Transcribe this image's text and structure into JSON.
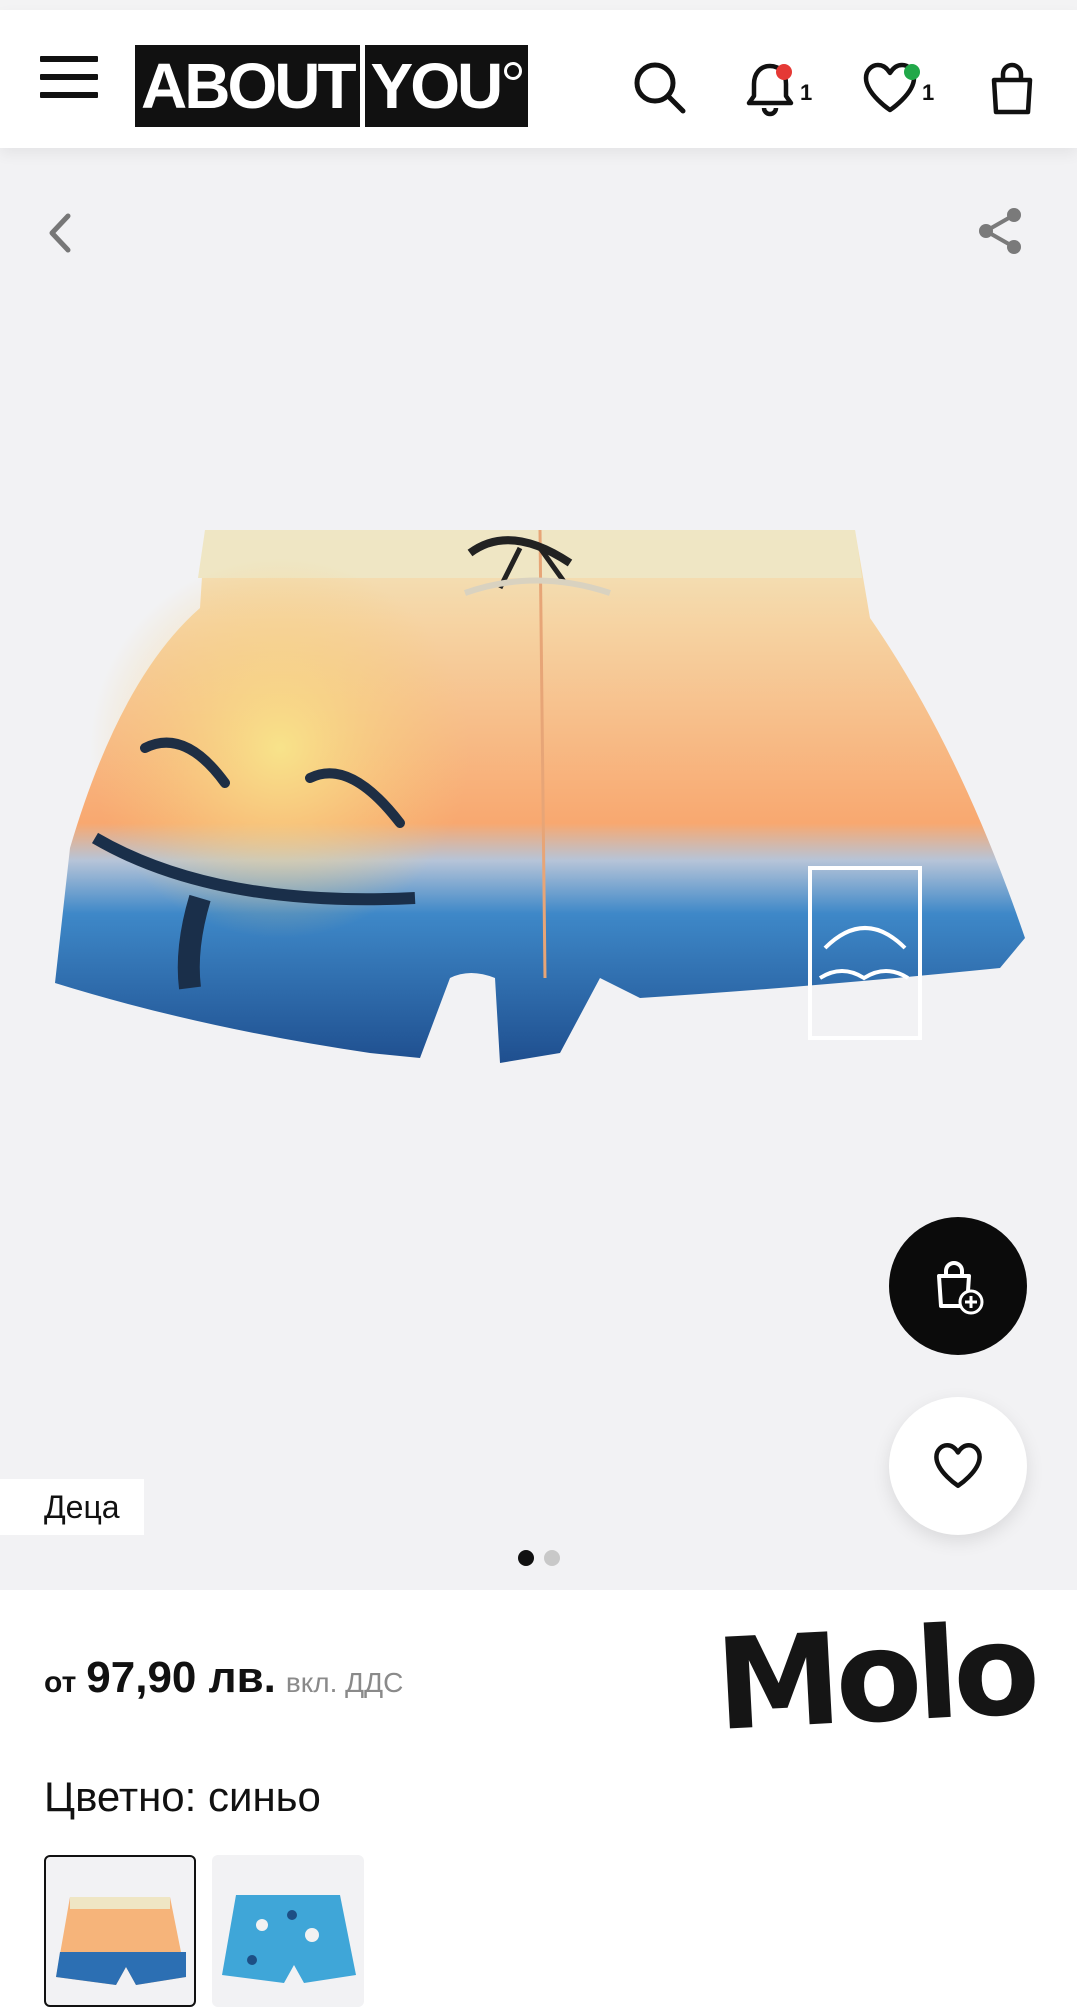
{
  "header": {
    "logo_left": "ABOUT",
    "logo_right": "YOU",
    "notifications_count": "1",
    "wishlist_count": "1"
  },
  "gallery": {
    "category_tag": "Деца",
    "page_dots": 2,
    "active_dot": 0
  },
  "product": {
    "price_prefix": "от",
    "price": "97,90 лв.",
    "vat_note": "вкл. ДДС",
    "brand": "Molo",
    "color_label": "Цветно: синьо"
  },
  "colors": {
    "accent_red": "#e53935",
    "accent_green": "#21a849",
    "text": "#111111",
    "muted": "#8a8a8a"
  }
}
